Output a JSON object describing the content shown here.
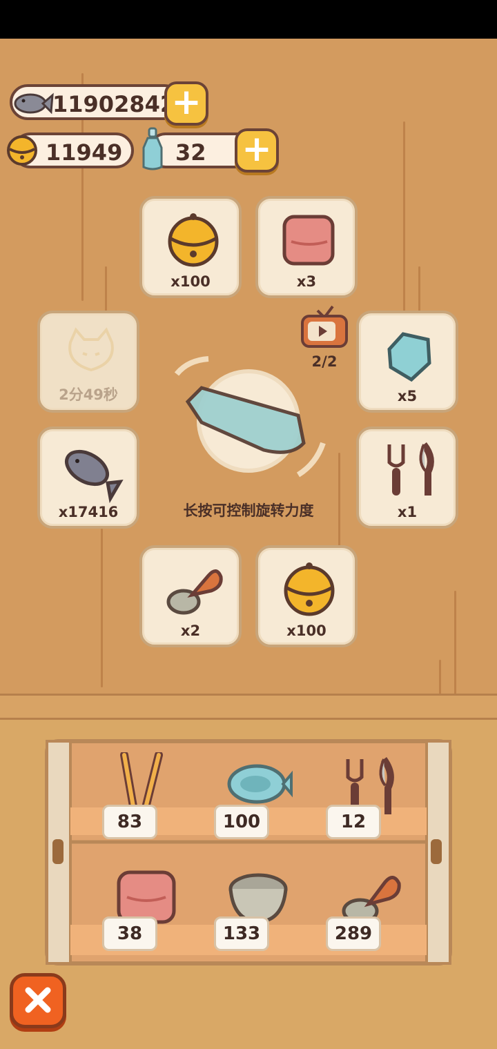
{
  "currency": {
    "fish": "11902842",
    "bell": "11949",
    "bottle": "32"
  },
  "prizes": {
    "top_left": "x100",
    "top_right": "x3",
    "mid_left_locked": "2分49秒",
    "mid_right": "x5",
    "low_left": "x17416",
    "low_right": "x1",
    "bottom_left": "x2",
    "bottom_right": "x100"
  },
  "ad_tv": {
    "count": "2/2"
  },
  "hint_text": "长按可控制旋转力度",
  "cabinet": {
    "top_shelf": [
      "83",
      "100",
      "12"
    ],
    "bottom_shelf": [
      "38",
      "133",
      "289"
    ]
  },
  "icons": {
    "fish": "fish-icon",
    "bell": "bell-icon",
    "bottle": "bottle-icon",
    "plus": "plus-icon",
    "close": "close-icon",
    "tv": "tv-icon"
  },
  "colors": {
    "wall": "#d39b5f",
    "tile": "#f7ead5",
    "gold": "#f6c240",
    "close": "#f06221"
  }
}
